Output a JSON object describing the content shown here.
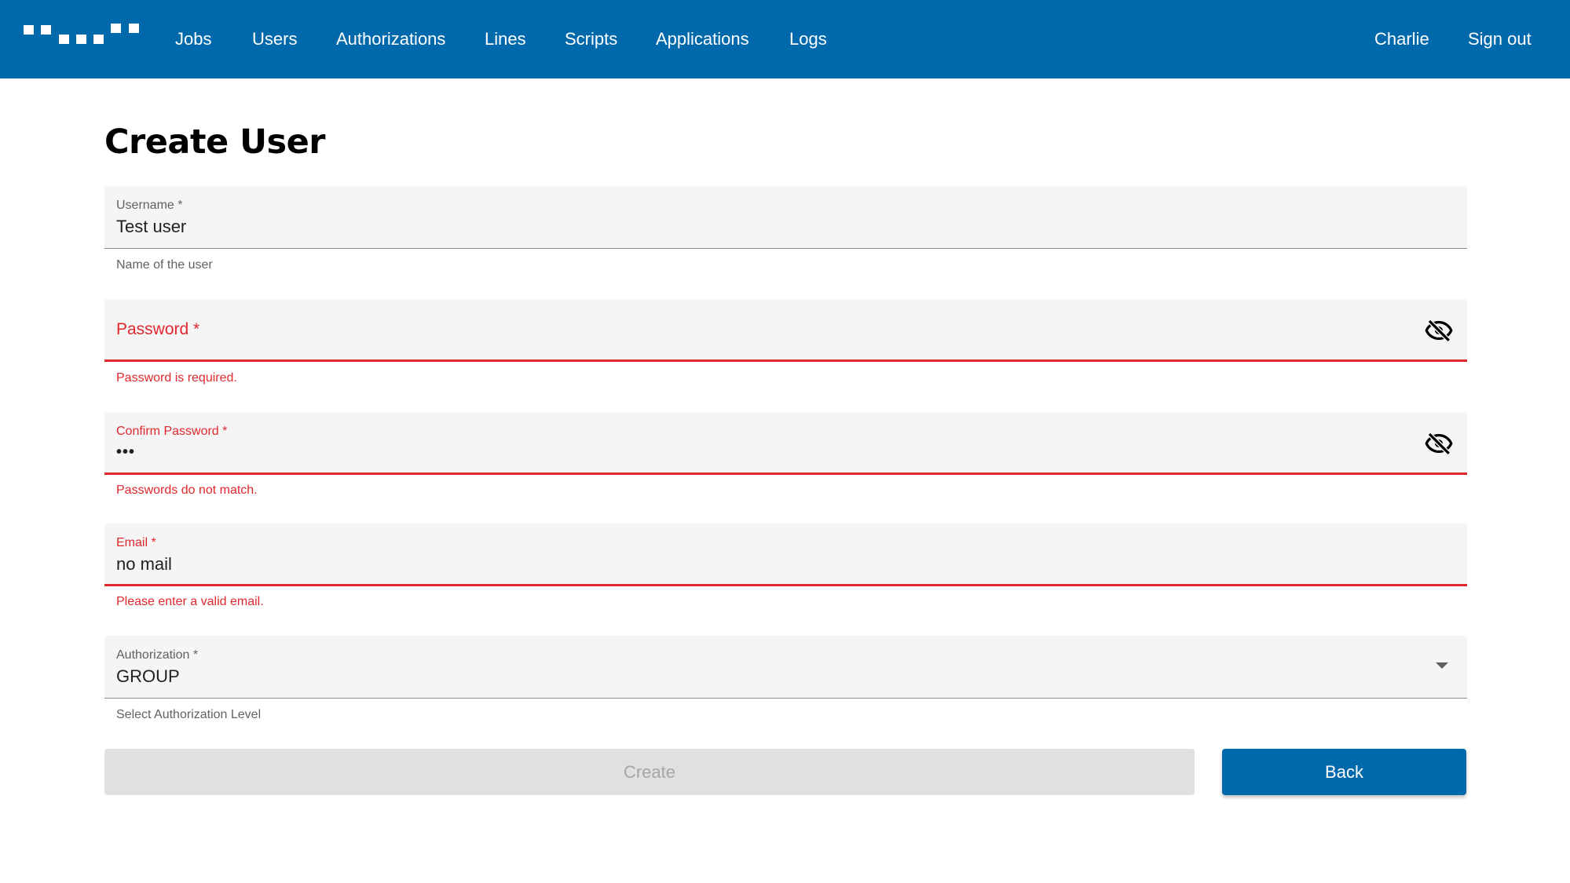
{
  "nav": {
    "items": [
      {
        "label": "Jobs"
      },
      {
        "label": "Users"
      },
      {
        "label": "Authorizations"
      },
      {
        "label": "Lines"
      },
      {
        "label": "Scripts"
      },
      {
        "label": "Applications"
      },
      {
        "label": "Logs"
      }
    ],
    "user_name": "Charlie",
    "sign_out": "Sign out"
  },
  "page": {
    "title": "Create User"
  },
  "form": {
    "username": {
      "label": "Username *",
      "value": "Test user",
      "hint": "Name of the user"
    },
    "password": {
      "label": "Password *",
      "value": "",
      "error": "Password is required."
    },
    "confirm_password": {
      "label": "Confirm Password *",
      "value": "•••",
      "error": "Passwords do not match."
    },
    "email": {
      "label": "Email *",
      "value": "no mail",
      "error": "Please enter a valid email."
    },
    "authorization": {
      "label": "Authorization *",
      "value": "GROUP",
      "hint": "Select Authorization Level"
    },
    "create_label": "Create",
    "back_label": "Back"
  },
  "colors": {
    "brand": "#0069ab",
    "error": "#e0282e",
    "field_bg": "#f5f5f5",
    "disabled_bg": "#e0e0e0"
  },
  "icons": {
    "visibility_toggle": "eye-off-icon",
    "select_arrow": "arrow-drop-down-icon"
  }
}
